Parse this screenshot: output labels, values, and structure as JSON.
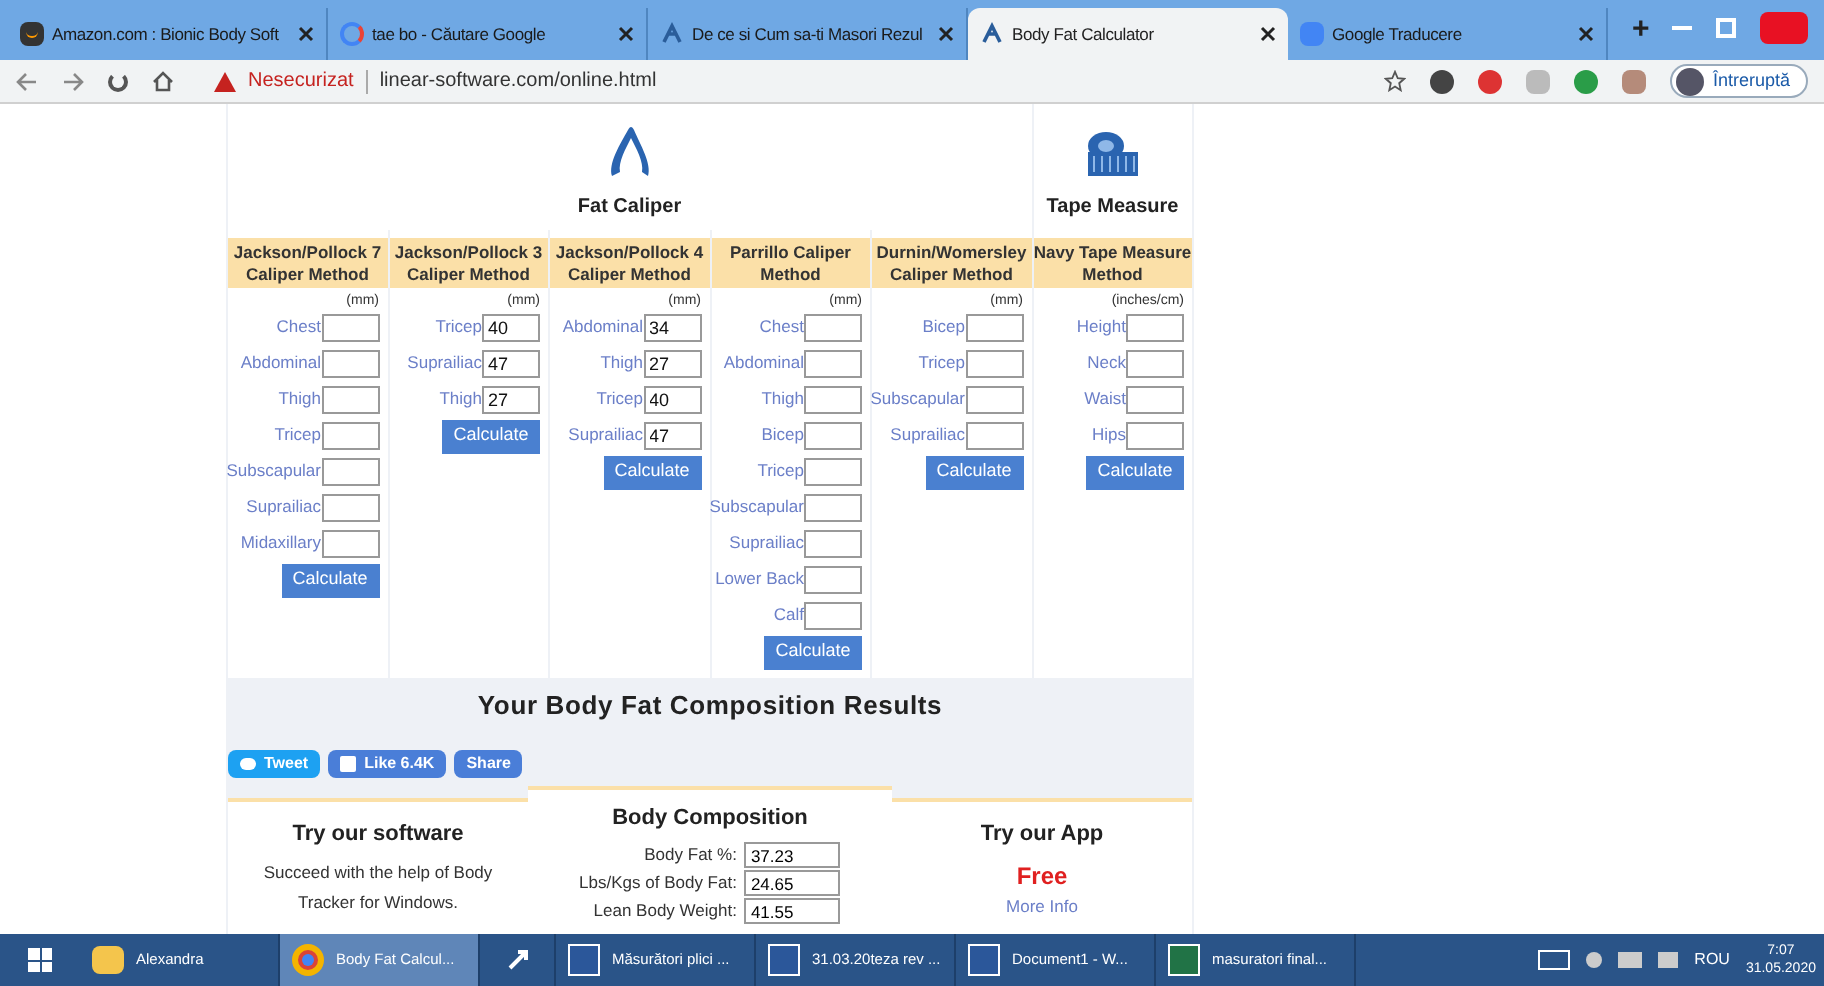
{
  "browser": {
    "tabs": [
      {
        "title": "Amazon.com : Bionic Body Soft",
        "selected": false
      },
      {
        "title": "tae bo - Căutare Google",
        "selected": false
      },
      {
        "title": "De ce si Cum sa-ti Masori Rezul",
        "selected": false
      },
      {
        "title": "Body Fat Calculator",
        "selected": true
      },
      {
        "title": "Google Traducere",
        "selected": false
      }
    ],
    "new_tab": "+",
    "address": {
      "warning": "Nesecurizat",
      "url": "linear-software.com/online.html"
    },
    "profile": "Întreruptă"
  },
  "page": {
    "groups": [
      {
        "title": "Fat Caliper"
      },
      {
        "title": "Tape Measure"
      }
    ],
    "methods": [
      {
        "title": "Jackson/Pollock 7 Caliper Method",
        "unit": "(mm)",
        "button": "Calculate",
        "fields": [
          {
            "label": "Chest"
          },
          {
            "label": "Abdominal"
          },
          {
            "label": "Thigh"
          },
          {
            "label": "Tricep"
          },
          {
            "label": "Subscapular"
          },
          {
            "label": "Suprailiac"
          },
          {
            "label": "Midaxillary"
          }
        ]
      },
      {
        "title": "Jackson/Pollock 3 Caliper Method",
        "unit": "(mm)",
        "button": "Calculate",
        "fields": [
          {
            "label": "Tricep",
            "value": "40"
          },
          {
            "label": "Suprailiac",
            "value": "47"
          },
          {
            "label": "Thigh",
            "value": "27"
          }
        ]
      },
      {
        "title": "Jackson/Pollock 4 Caliper Method",
        "unit": "(mm)",
        "button": "Calculate",
        "fields": [
          {
            "label": "Abdominal",
            "value": "34"
          },
          {
            "label": "Thigh",
            "value": "27"
          },
          {
            "label": "Tricep",
            "value": "40"
          },
          {
            "label": "Suprailiac",
            "value": "47"
          }
        ]
      },
      {
        "title": "Parrillo Caliper Method",
        "unit": "(mm)",
        "button": "Calculate",
        "fields": [
          {
            "label": "Chest"
          },
          {
            "label": "Abdominal"
          },
          {
            "label": "Thigh"
          },
          {
            "label": "Bicep"
          },
          {
            "label": "Tricep"
          },
          {
            "label": "Subscapular"
          },
          {
            "label": "Suprailiac"
          },
          {
            "label": "Lower Back"
          },
          {
            "label": "Calf"
          }
        ]
      },
      {
        "title": "Durnin/Womersley Caliper Method",
        "unit": "(mm)",
        "button": "Calculate",
        "fields": [
          {
            "label": "Bicep"
          },
          {
            "label": "Tricep"
          },
          {
            "label": "Subscapular"
          },
          {
            "label": "Suprailiac"
          }
        ]
      },
      {
        "title": "Navy Tape Measure Method",
        "unit": "(inches/cm)",
        "button": "Calculate",
        "fields": [
          {
            "label": "Height"
          },
          {
            "label": "Neck"
          },
          {
            "label": "Waist"
          },
          {
            "label": "Hips"
          }
        ]
      }
    ],
    "results_title": "Your Body Fat Composition Results",
    "social": [
      {
        "kind": "tweet",
        "label": "Tweet"
      },
      {
        "kind": "like",
        "label": "Like 6.4K"
      },
      {
        "kind": "share",
        "label": "Share"
      }
    ],
    "software": {
      "title": "Try our software",
      "text": "Succeed with the help of Body Tracker for Windows."
    },
    "composition": {
      "title": "Body Composition",
      "rows": [
        {
          "label": "Body Fat %:",
          "value": "37.23"
        },
        {
          "label": "Lbs/Kgs of Body Fat:",
          "value": "24.65"
        },
        {
          "label": "Lean Body Weight:",
          "value": "41.55"
        }
      ]
    },
    "app": {
      "title": "Try our App",
      "price": "Free",
      "link": "More Info"
    }
  },
  "taskbar": {
    "items": [
      {
        "kind": "folder",
        "label": "Alexandra",
        "selected": false
      },
      {
        "kind": "chrome",
        "label": "Body Fat Calcul...",
        "selected": true
      },
      {
        "kind": "pin",
        "selected": false
      },
      {
        "kind": "word",
        "label": "Măsurători plici ...",
        "selected": false
      },
      {
        "kind": "word",
        "label": "31.03.20teza rev ...",
        "selected": false
      },
      {
        "kind": "word",
        "label": "Document1 - W...",
        "selected": false
      },
      {
        "kind": "excel",
        "label": "masuratori final...",
        "selected": false
      }
    ],
    "language": "ROU",
    "time": "7:07",
    "date": "31.05.2020"
  }
}
